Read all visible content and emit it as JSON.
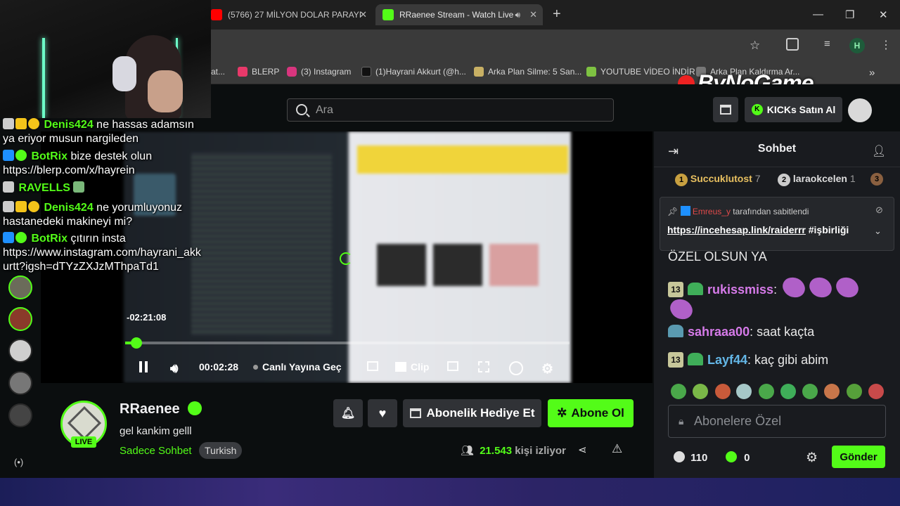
{
  "browser": {
    "tabs": [
      {
        "label": "(5766) 27 MİLYON DOLAR PARAYI",
        "active": false
      },
      {
        "label": "RRaenee Stream - Watch Live",
        "active": true
      }
    ],
    "new_tab": "+",
    "profile_initial": "H",
    "bookmarks": [
      "at...",
      "BLERP",
      "(3) Instagram",
      "(1)Hayrani Akkurt (@h...",
      "Arka Plan Silme: 5 San...",
      "YOUTUBE VİDEO İNDİR",
      "Arka Plan Kaldırma Ar..."
    ]
  },
  "watermark": "ByNoGame",
  "header": {
    "search_placeholder": "Ara",
    "kicks_button": "KICKs Satın Al"
  },
  "player": {
    "remaining": "-02:21:08",
    "elapsed": "00:02:28",
    "go_live": "Canlı Yayına Geç",
    "clip": "Clip",
    "progress_fraction": 0.025
  },
  "overlay_chat": [
    {
      "name": "Denis424",
      "text": "ne hassas adamsın",
      "cont": "ya eriyor musun nargileden",
      "color": "#53fc18"
    },
    {
      "name": "BotRix",
      "text": "bize destek olun",
      "cont": "https://blerp.com/x/hayrein",
      "color": "#53fc18"
    },
    {
      "name": "RAVELLS",
      "text": "",
      "cont": "",
      "color": "#53fc18"
    },
    {
      "name": "Denis424",
      "text": "ne yorumluyonuz",
      "cont": "hastanedeki makineyi mi?",
      "color": "#53fc18"
    },
    {
      "name": "BotRix",
      "text": "çıtırın insta",
      "cont": "https://www.instagram.com/hayrani_akk",
      "cont2": "urtt?igsh=dTYzZXJzMThpaTd1",
      "color": "#53fc18"
    }
  ],
  "channel": {
    "name": "RRaenee",
    "live_badge": "LIVE",
    "title": "gel kankim gelll",
    "category": "Sadece Sohbet",
    "tag": "Turkish",
    "viewers": "21.543",
    "viewers_label": "kişi izliyor",
    "gift_button": "Abonelik Hediye Et",
    "subscribe_button": "Abone Ol"
  },
  "chat": {
    "title": "Sohbet",
    "leaderboard": [
      {
        "rank": "1",
        "name": "Succuklutost",
        "count": "7"
      },
      {
        "rank": "2",
        "name": "laraokcelen",
        "count": "1"
      },
      {
        "rank": "3",
        "name": "",
        "count": ""
      }
    ],
    "pinned_by": "Emreus_y",
    "pinned_suffix": "tarafından sabitlendi",
    "pinned_link": "https://incehesap.link/raiderrr",
    "pinned_tag": "#işbirliği",
    "messages": [
      {
        "badge": "",
        "name": "",
        "text": "ÖZEL OLSUN YA",
        "color": "#e8e8e8"
      },
      {
        "badge": "13",
        "name": "rukissmiss",
        "text": ":",
        "color": "#d57ae8"
      },
      {
        "badge": "",
        "name": "sahraaa00",
        "text": ": saat kaçta",
        "color": "#d57ae8"
      },
      {
        "badge": "13",
        "name": "Layf44",
        "text": ": kaç gibi abim",
        "color": "#63b6e6"
      }
    ],
    "input_placeholder": "Abonelere Özel",
    "points": "110",
    "kicks": "0",
    "send_button": "Gönder"
  },
  "colors": {
    "accent": "#53fc18",
    "panel": "#191b1f",
    "button": "#303236"
  }
}
